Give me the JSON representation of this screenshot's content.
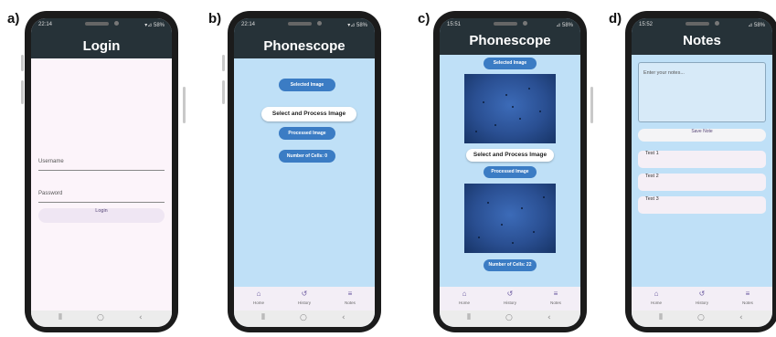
{
  "labels": {
    "a": "a)",
    "b": "b)",
    "c": "c)",
    "d": "d)"
  },
  "colors": {
    "appbar": "#263238",
    "app_bg": "#bfe0f7",
    "login_bg": "#fcf4fa",
    "button_blue": "#3b7cc4"
  },
  "screen_a": {
    "status_time": "22:14",
    "status_right": "▾⊿ 58%",
    "title": "Login",
    "username_label": "Username",
    "password_label": "Password",
    "login_button": "Login"
  },
  "screen_b": {
    "status_time": "22:14",
    "status_right": "▾⊿ 58%",
    "title": "Phonescope",
    "selected_image_button": "Selected Image",
    "select_process_button": "Select and Process Image",
    "processed_image_button": "Processed Image",
    "cell_count_button": "Number of Cells: 0",
    "nav": [
      {
        "label": "Home",
        "icon": "home-icon"
      },
      {
        "label": "History",
        "icon": "history-icon"
      },
      {
        "label": "Notes",
        "icon": "notes-icon"
      }
    ]
  },
  "screen_c": {
    "status_time": "15:51",
    "status_right": "⊿ 58%",
    "title": "Phonescope",
    "selected_image_button": "Selected Image",
    "select_process_button": "Select and Process Image",
    "processed_image_button": "Processed Image",
    "cell_count_button": "Number of Cells: 22",
    "nav": [
      {
        "label": "Home",
        "icon": "home-icon"
      },
      {
        "label": "History",
        "icon": "history-icon"
      },
      {
        "label": "Notes",
        "icon": "notes-icon"
      }
    ]
  },
  "screen_d": {
    "status_time": "15:52",
    "status_right": "⊿ 58%",
    "title": "Notes",
    "notes_placeholder": "Enter your notes...",
    "save_button": "Save Note",
    "notes": [
      "Test 1",
      "Test 2",
      "Test 3"
    ],
    "nav": [
      {
        "label": "Home",
        "icon": "home-icon"
      },
      {
        "label": "History",
        "icon": "history-icon"
      },
      {
        "label": "Notes",
        "icon": "notes-icon"
      }
    ]
  }
}
